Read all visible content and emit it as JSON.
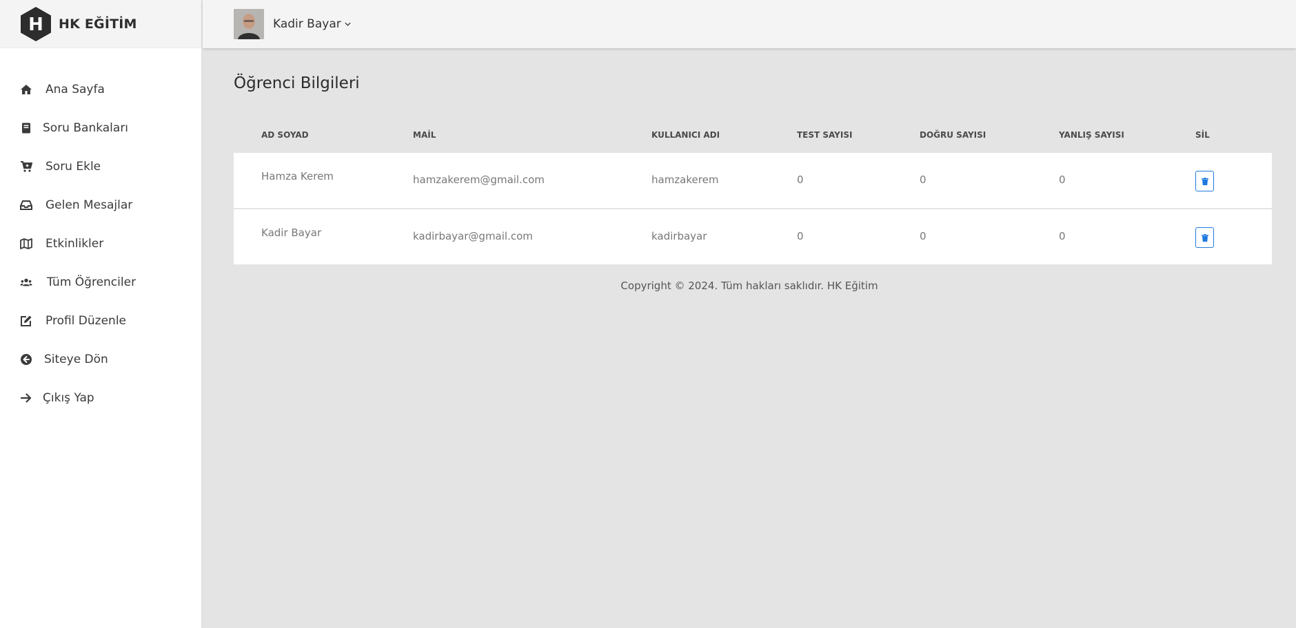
{
  "brand": {
    "logo_letter": "H",
    "name": "HK EĞİTİM"
  },
  "sidebar": {
    "items": [
      {
        "label": "Ana Sayfa",
        "icon": "home-icon"
      },
      {
        "label": "Soru Bankaları",
        "icon": "book-icon"
      },
      {
        "label": "Soru Ekle",
        "icon": "cart-plus-icon"
      },
      {
        "label": "Gelen Mesajlar",
        "icon": "inbox-icon"
      },
      {
        "label": "Etkinlikler",
        "icon": "map-icon"
      },
      {
        "label": "Tüm Öğrenciler",
        "icon": "users-icon"
      },
      {
        "label": "Profil Düzenle",
        "icon": "edit-icon"
      },
      {
        "label": "Siteye Dön",
        "icon": "arrow-circle-left-icon"
      },
      {
        "label": "Çıkış Yap",
        "icon": "arrow-right-icon"
      }
    ]
  },
  "header": {
    "user_name": "Kadir Bayar",
    "caret": "⌄"
  },
  "main": {
    "title": "Öğrenci Bilgileri",
    "table": {
      "columns": [
        "AD SOYAD",
        "MAİL",
        "KULLANICI ADI",
        "TEST SAYISI",
        "DOĞRU SAYISI",
        "YANLIŞ SAYISI",
        "SİL"
      ],
      "rows": [
        {
          "name": "Hamza Kerem",
          "mail": "hamzakerem@gmail.com",
          "username": "hamzakerem",
          "test": "0",
          "dogru": "0",
          "yanlis": "0"
        },
        {
          "name": "Kadir Bayar",
          "mail": "kadirbayar@gmail.com",
          "username": "kadirbayar",
          "test": "0",
          "dogru": "0",
          "yanlis": "0"
        }
      ]
    }
  },
  "footer": {
    "text": "Copyright © 2024. Tüm hakları saklıdır. HK Eğitim"
  },
  "colors": {
    "accent": "#1f7ae0",
    "background": "#e4e4e4",
    "sidebar": "#ffffff",
    "topbar": "#f4f4f4"
  }
}
